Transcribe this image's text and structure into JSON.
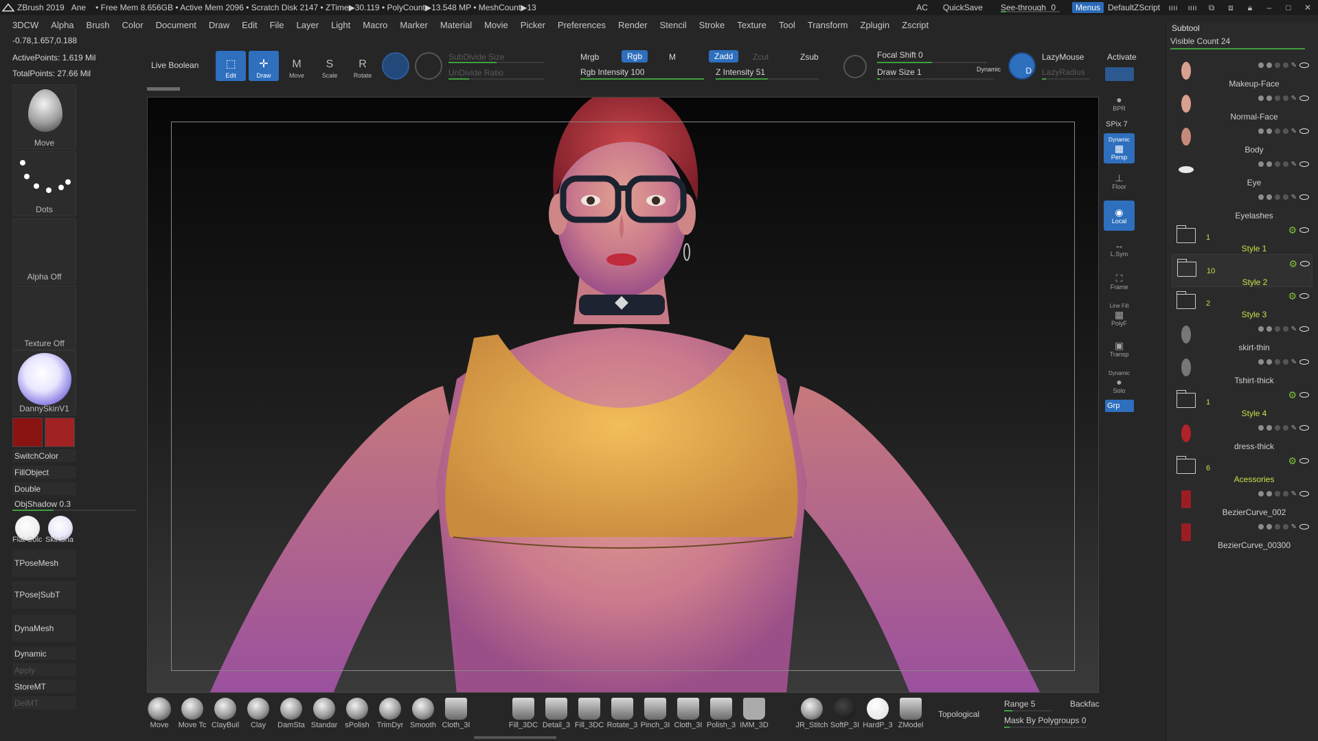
{
  "titlebar": {
    "app_name": "ZBrush 2019",
    "user": "Ane",
    "stats": "• Free Mem 8.656GB • Active Mem 2096 • Scratch Disk 2147 • ZTime▶30.119 • PolyCount▶13.548 MP • MeshCount▶13",
    "ac_label": "AC",
    "quicksave_label": "QuickSave",
    "seethrough_label": "See-through",
    "seethrough_value": "0",
    "menus_label": "Menus",
    "script_label": "DefaultZScript"
  },
  "menubar": {
    "items": [
      "3DCW",
      "Alpha",
      "Brush",
      "Color",
      "Document",
      "Draw",
      "Edit",
      "File",
      "Layer",
      "Light",
      "Macro",
      "Marker",
      "Material",
      "Movie",
      "Picker",
      "Preferences",
      "Render",
      "Stencil",
      "Stroke",
      "Texture",
      "Tool",
      "Transform",
      "Zplugin",
      "Zscript"
    ]
  },
  "info": {
    "coords": "-0.78,1.657,0.188",
    "active_points": "ActivePoints: 1.619 Mil",
    "total_points": "TotalPoints: 27.66 Mil"
  },
  "shelf": {
    "live_boolean": "Live Boolean",
    "edit": "Edit",
    "draw": "Draw",
    "move": "Move",
    "scale": "Scale",
    "rotate": "Rotate",
    "subdivide_size": "SubDivide Size",
    "undivide_ratio": "UnDivide Ratio",
    "mrgb": "Mrgb",
    "rgb": "Rgb",
    "m": "M",
    "rgb_intensity": "Rgb Intensity 100",
    "zadd": "Zadd",
    "zcut": "Zcut",
    "zsub": "Zsub",
    "z_intensity": "Z Intensity 51",
    "focal_shift": "Focal Shift 0",
    "draw_size": "Draw Size 1",
    "dynamic": "Dynamic",
    "lazymouse": "LazyMouse",
    "lazyradius": "LazyRadius",
    "activate": "Activate"
  },
  "left": {
    "brush_label": "Move",
    "stroke_label": "Dots",
    "alpha_label": "Alpha Off",
    "texture_label": "Texture Off",
    "material_label": "DannySkinV1",
    "switch_color": "SwitchColor",
    "fill_object": "FillObject",
    "double": "Double",
    "obj_shadow": "ObjShadow",
    "obj_shadow_value": "0.3",
    "flat_color": "Flat Colc",
    "skin_shade": "SkinSha",
    "tpose_mesh": "TPoseMesh",
    "tpose_subt": "TPose|SubT",
    "dynamesh": "DynaMesh",
    "dynamic": "Dynamic",
    "apply": "Apply",
    "storemt": "StoreMT",
    "delmt": "DelMT",
    "main_color": "#8a1414",
    "secondary_color": "#a02222"
  },
  "rtools": {
    "bpr": "BPR",
    "spix": "SPix 7",
    "dynamic": "Dynamic",
    "persp": "Persp",
    "floor": "Floor",
    "local": "Local",
    "lsym": "L.Sym",
    "frame": "Frame",
    "linefill": "Line Fill",
    "polyf": "PolyF",
    "transp": "Transp",
    "dynamic2": "Dynamic",
    "solo": "Solo",
    "grp": "Grp"
  },
  "subtool": {
    "title": "Subtool",
    "visible_count": "Visible Count 24",
    "items": [
      {
        "name": "Makeup-Face",
        "kind": "head"
      },
      {
        "name": "Normal-Face",
        "kind": "head"
      },
      {
        "name": "Body",
        "kind": "body"
      },
      {
        "name": "Eye",
        "kind": "eye"
      },
      {
        "name": "Eyelashes",
        "kind": "none"
      },
      {
        "name": "Style 1",
        "kind": "folder",
        "count": "1"
      },
      {
        "name": "Style 2",
        "kind": "folder-sel",
        "count": "10"
      },
      {
        "name": "Style 3",
        "kind": "folder",
        "count": "2"
      },
      {
        "name": "skirt-thin",
        "kind": "cloth"
      },
      {
        "name": "Tshirt-thick",
        "kind": "cloth"
      },
      {
        "name": "Style 4",
        "kind": "folder",
        "count": "1"
      },
      {
        "name": "dress-thick",
        "kind": "dress"
      },
      {
        "name": "Acessories",
        "kind": "folder",
        "count": "6"
      },
      {
        "name": "BezierCurve_002",
        "kind": "curve"
      },
      {
        "name": "BezierCurve_00300",
        "kind": "curve"
      }
    ]
  },
  "bottom": {
    "brushes": [
      "Move",
      "Move Tc",
      "ClayBuil",
      "Clay",
      "DamSta",
      "Standar",
      "sPolish",
      "TrimDyr",
      "Smooth",
      "Cloth_3I"
    ],
    "brushes2": [
      "Fill_3DC",
      "Detail_3",
      "Fill_3DC",
      "Rotate_3",
      "Pinch_3I",
      "Cloth_3I",
      "Polish_3",
      "IMM_3D"
    ],
    "brushes3": [
      "JR_Stitch",
      "SoftP_3I",
      "HardP_3",
      "ZModel"
    ],
    "topological": "Topological",
    "range": "Range 5",
    "backface": "Backfac",
    "mask_by_polygroups": "Mask By Polygroups 0"
  }
}
